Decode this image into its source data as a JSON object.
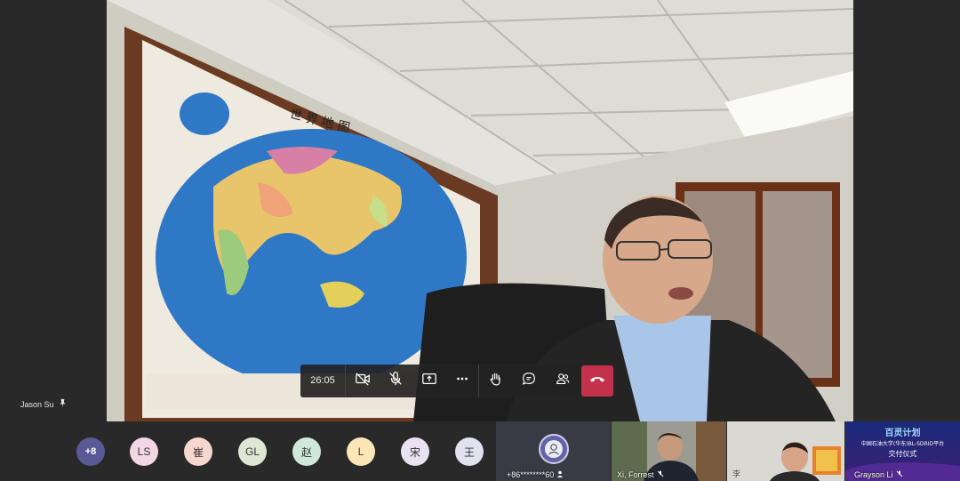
{
  "call": {
    "timer": "26:05",
    "pinned_participant": "Jason Su"
  },
  "controls": {
    "camera": "camera-off-icon",
    "mic": "mic-off-icon",
    "share": "share-screen-icon",
    "more": "more-actions-icon",
    "raise_hand": "raise-hand-icon",
    "chat": "chat-icon",
    "participants": "participants-icon",
    "hang_up": "hang-up-icon",
    "hang_up_color": "#c4314b"
  },
  "roster": {
    "overflow": "+8",
    "avatars": [
      {
        "initials": "LS",
        "color": "#f3d6e3"
      },
      {
        "initials": "崔",
        "color": "#f6d7cf"
      },
      {
        "initials": "GL",
        "color": "#dde7d4"
      },
      {
        "initials": "赵",
        "color": "#cfe8d9"
      },
      {
        "initials": "L",
        "color": "#fbe6b8"
      },
      {
        "initials": "宋",
        "color": "#e8e2f3"
      },
      {
        "initials": "王",
        "color": "#e1e1f0"
      }
    ]
  },
  "tiles": [
    {
      "name": "+86********60"
    },
    {
      "name": "Xi, Forrest"
    },
    {
      "name": "李"
    },
    {
      "name": "Grayson Li",
      "banner_title": "百灵计划",
      "banner_line1": "中国石油大学(华东)BL-SDRID平台",
      "banner_line2": "交付仪式"
    }
  ]
}
